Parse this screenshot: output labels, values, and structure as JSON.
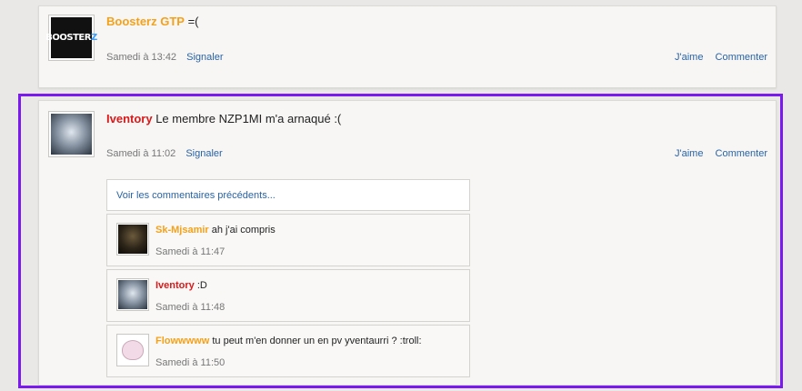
{
  "posts": [
    {
      "author": "Boosterz GTP",
      "message": "=(",
      "time": "Samedi à 13:42",
      "report": "Signaler",
      "like": "J'aime",
      "comment": "Commenter"
    },
    {
      "author": "Iventory",
      "message": "Le membre NZP1MI m'a arnaqué :(",
      "time": "Samedi à 11:02",
      "report": "Signaler",
      "like": "J'aime",
      "comment": "Commenter",
      "more_comments": "Voir les commentaires précédents...",
      "comments": [
        {
          "author": "Sk-Mjsamir",
          "text": "ah j'ai compris",
          "time": "Samedi à 11:47"
        },
        {
          "author": "Iventory",
          "text": ":D",
          "time": "Samedi à 11:48"
        },
        {
          "author": "Flowwwww",
          "text": "tu peut m'en donner un en pv yventaurri ? :troll:",
          "time": "Samedi à 11:50"
        }
      ]
    }
  ],
  "colors": {
    "orange_author": "#f4a11a",
    "red_author": "#d81a1a",
    "link": "#2a63a4",
    "highlight": "#7a1af0"
  }
}
